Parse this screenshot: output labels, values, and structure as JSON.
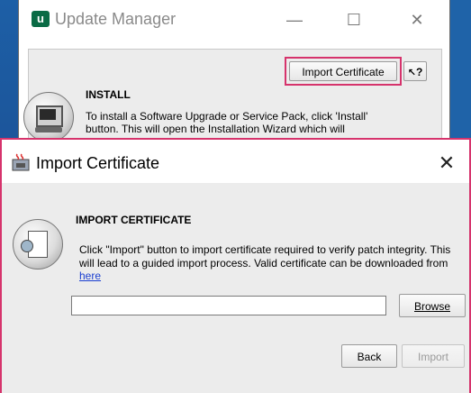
{
  "background_window": {
    "title": "Update Manager",
    "controls": {
      "minimize": "—",
      "maximize": "☐",
      "close": "✕"
    },
    "import_certificate_button": "Import Certificate",
    "help_button": "?",
    "install": {
      "heading": "INSTALL",
      "text": "To install a Software Upgrade or Service Pack, click 'Install' button. This will open the Installation Wizard which will"
    }
  },
  "dialog": {
    "title": "Import Certificate",
    "close": "✕",
    "heading": "IMPORT CERTIFICATE",
    "description_before_link": "Click \"Import\" button to import certificate required to verify patch integrity. This will lead to a guided import process. Valid certificate can be downloaded from ",
    "link_text": "here",
    "certificate_path": {
      "value": "",
      "placeholder": ""
    },
    "browse_button": "Browse",
    "back_button": "Back",
    "import_button": "Import"
  },
  "colors": {
    "highlight": "#d6336c",
    "link": "#1a3fd0",
    "desktop": "#1f63a8"
  }
}
